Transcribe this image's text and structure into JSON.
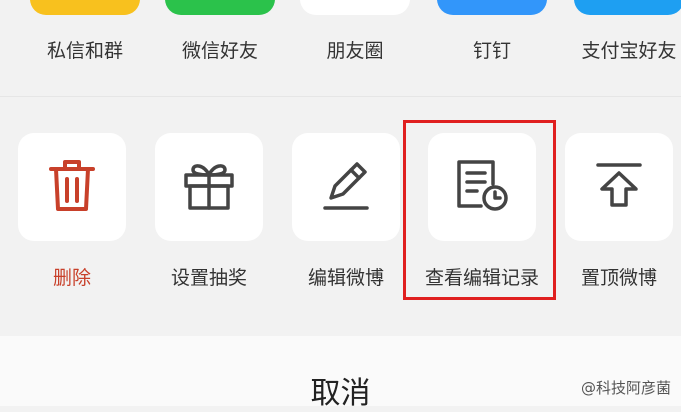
{
  "share_targets": [
    {
      "label": "私信和群",
      "color": "#f8c11e",
      "icon": "private-message-icon"
    },
    {
      "label": "微信好友",
      "color": "#2bc24b",
      "icon": "wechat-icon"
    },
    {
      "label": "朋友圈",
      "color": "#ffffff",
      "icon": "moments-icon"
    },
    {
      "label": "钉钉",
      "color": "#3296fa",
      "icon": "dingtalk-icon"
    },
    {
      "label": "支付宝好友",
      "color": "#1e9ff2",
      "icon": "alipay-icon"
    }
  ],
  "actions": [
    {
      "label": "删除",
      "icon": "trash-icon",
      "color": "#c8402a"
    },
    {
      "label": "设置抽奖",
      "icon": "gift-icon",
      "color": "#444444"
    },
    {
      "label": "编辑微博",
      "icon": "pencil-icon",
      "color": "#444444"
    },
    {
      "label": "查看编辑记录",
      "icon": "edit-history-icon",
      "color": "#444444"
    },
    {
      "label": "置顶微博",
      "icon": "pin-top-icon",
      "color": "#444444"
    }
  ],
  "highlight_color": "#e02020",
  "cancel_label": "取消",
  "watermark": "@科技阿彦菌"
}
